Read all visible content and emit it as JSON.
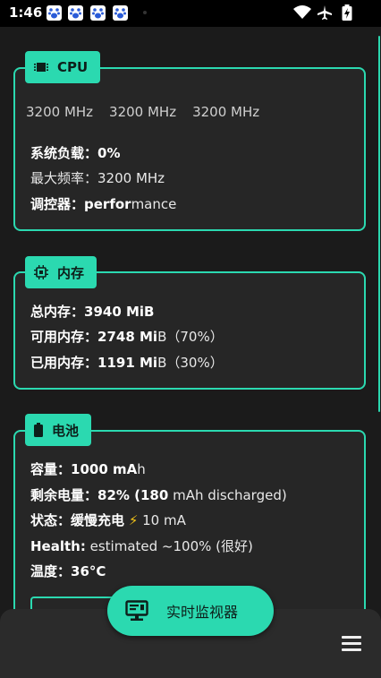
{
  "status_bar": {
    "time": "1:46",
    "notification_icons": [
      "baidu-paw-icon",
      "baidu-paw-icon",
      "baidu-paw-icon",
      "baidu-paw-icon"
    ],
    "system_icons": [
      "wifi-icon",
      "airplane-icon",
      "battery-charging-icon"
    ]
  },
  "cpu": {
    "title": "CPU",
    "frequencies": [
      "3200 MHz",
      "3200 MHz",
      "3200 MHz"
    ],
    "load_label": "系统负载：",
    "load_value": "0%",
    "max_freq_label": "最大频率：",
    "max_freq_value": "3200 MHz",
    "governor_label": "调控器：",
    "governor_value_bold": "perfor",
    "governor_value_rest": "mance"
  },
  "memory": {
    "title": "内存",
    "total_label": "总内存：",
    "total_value": "3940 MiB",
    "available_label": "可用内存：",
    "available_value": "2748 Mi",
    "available_rest": "B（70%）",
    "used_label": "已用内存：",
    "used_value": "1191 Mi",
    "used_rest": "B（30%）"
  },
  "battery": {
    "title": "电池",
    "capacity_label": "容量：",
    "capacity_value": "1000 mA",
    "capacity_rest": "h",
    "remaining_label": "剩余电量：",
    "remaining_value": "82% (180",
    "remaining_rest": " mAh discharged)",
    "status_label": "状态：",
    "status_value": "缓慢充电",
    "status_current": "10 mA",
    "health_label": "Health:",
    "health_value": " estimated ~100% (很好)",
    "temp_label": "温度：",
    "temp_value": "36°C"
  },
  "fab": {
    "label": "实时监视器"
  },
  "colors": {
    "accent": "#2bd9b0",
    "card_bg": "#262626",
    "page_bg": "#1b1b1b"
  }
}
